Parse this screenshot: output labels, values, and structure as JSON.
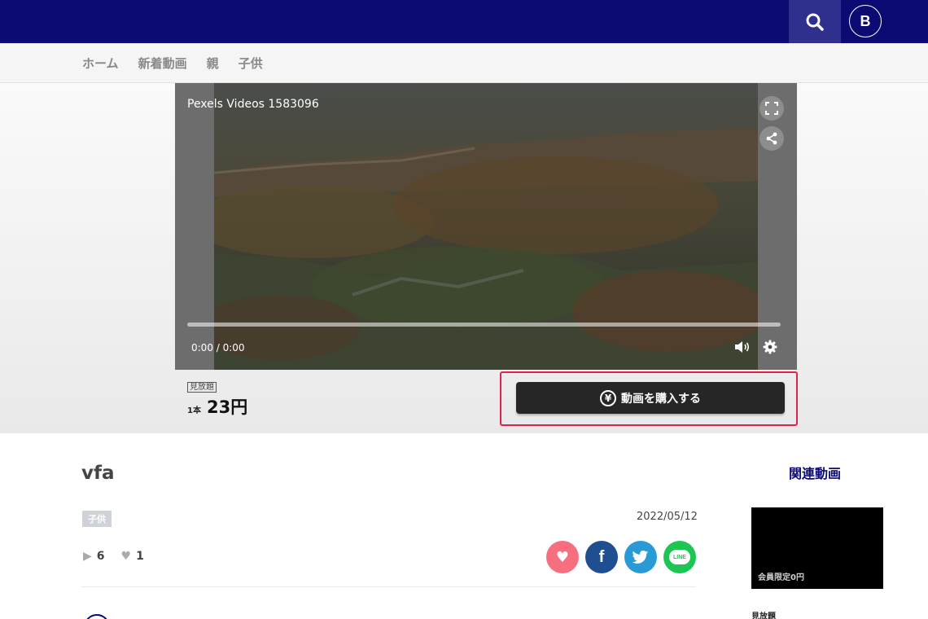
{
  "header": {
    "avatar_letter": "B",
    "colors": {
      "bar": "#0b0b73",
      "search_bg": "#2f2f8d"
    }
  },
  "nav": {
    "items": [
      {
        "label": "ホーム"
      },
      {
        "label": "新着動画"
      },
      {
        "label": "親"
      },
      {
        "label": "子供"
      }
    ]
  },
  "player": {
    "title": "Pexels Videos 1583096",
    "time": "0:00 / 0:00",
    "icons": [
      "fullscreen-icon",
      "share-icon",
      "volume-icon",
      "settings-icon"
    ]
  },
  "purchase": {
    "plan_tag": "見放題",
    "unit": "1本",
    "price": "23円",
    "buy_label": "動画を購入する",
    "yen_symbol": "¥",
    "colors": {
      "highlight": "#e0224a",
      "button": "#262626"
    }
  },
  "video": {
    "title": "vfa",
    "tag": "子供",
    "date": "2022/05/12",
    "views": "6",
    "likes": "1"
  },
  "share": {
    "buttons": [
      "heart-icon",
      "facebook-icon",
      "twitter-icon",
      "line-icon"
    ],
    "line_text": "LINE",
    "colors": {
      "like": "#f76f7e",
      "facebook": "#1f4e91",
      "twitter": "#2a9ad6",
      "line": "#1dc652"
    }
  },
  "sidebar": {
    "heading": "関連動画",
    "card_badge": "会員限定0円",
    "card_label": "見放題"
  }
}
